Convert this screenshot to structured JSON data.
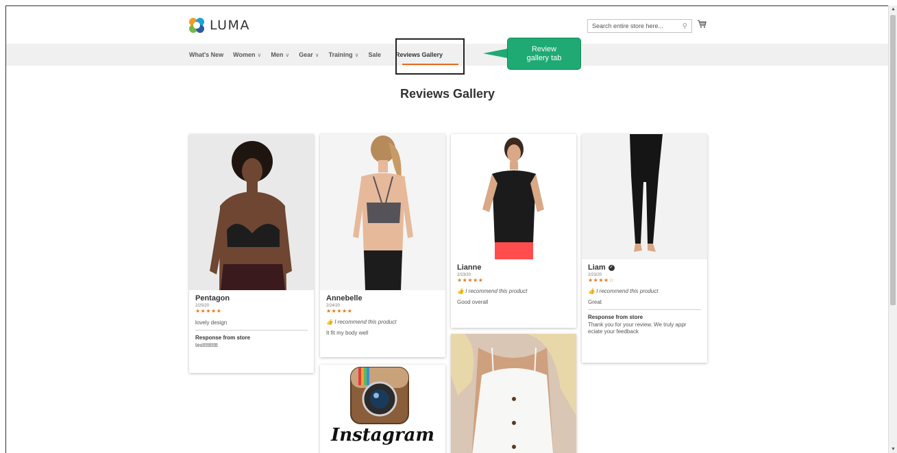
{
  "header": {
    "logo_text": "LUMA",
    "search_placeholder": "Search entire store here...",
    "cart_icon": "cart-icon"
  },
  "nav": {
    "items": [
      {
        "label": "What's New",
        "has_dropdown": false
      },
      {
        "label": "Women",
        "has_dropdown": true
      },
      {
        "label": "Men",
        "has_dropdown": true
      },
      {
        "label": "Gear",
        "has_dropdown": true
      },
      {
        "label": "Training",
        "has_dropdown": true
      },
      {
        "label": "Sale",
        "has_dropdown": false
      },
      {
        "label": "Reviews Gallery",
        "has_dropdown": false,
        "active": true
      }
    ],
    "chevron": "∨"
  },
  "callout": {
    "line1": "Review",
    "line2": "gallery tab"
  },
  "page_title": "Reviews Gallery",
  "reviews": [
    {
      "name": "Pentagon",
      "date": "2/25/20",
      "stars": "★★★★★",
      "text": "lovely design",
      "response_label": "Response from store",
      "response_text": "testttttttttt"
    },
    {
      "name": "Annebelle",
      "date": "2/24/20",
      "stars": "★★★★★",
      "recommend": "I recommend this product",
      "text": "It fit my body well"
    },
    {
      "name": "Lianne",
      "date": "2/23/20",
      "stars": "★★★★★",
      "recommend": "I recommend this product",
      "text": "Good overall"
    },
    {
      "name": "Liam",
      "verified": true,
      "date": "2/23/20",
      "stars": "★★★★☆",
      "recommend": "I recommend this product",
      "text": "Great",
      "response_label": "Response from store",
      "response_text": "Thank you for your review. We truly appr eciate your feedback"
    }
  ],
  "instagram_word": "Instagram",
  "colors": {
    "accent": "#e86a1c",
    "stars": "#e07b1a",
    "callout": "#1faa73",
    "navbar": "#f0f0f0"
  }
}
